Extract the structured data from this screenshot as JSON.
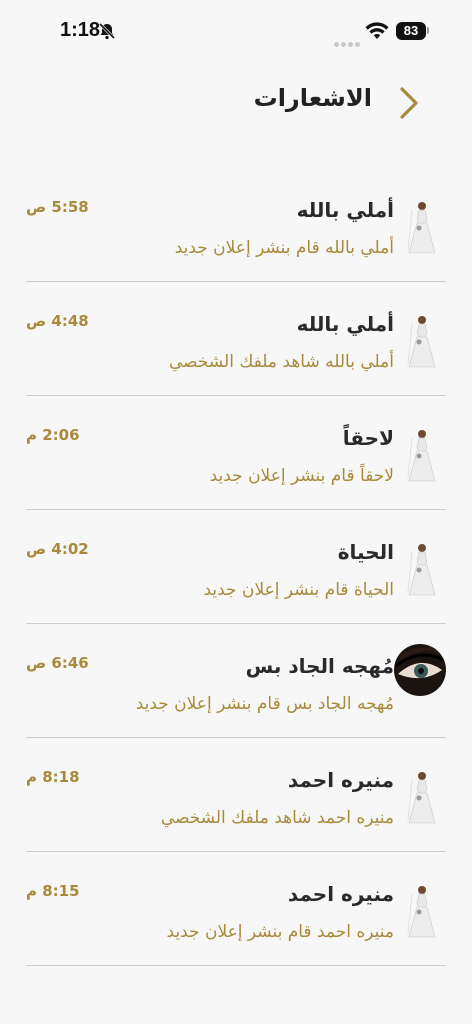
{
  "status": {
    "time": "1:18",
    "battery": "83"
  },
  "header": {
    "title": "الاشعارات"
  },
  "notifications": [
    {
      "name": "أملي بالله",
      "message": "أملي بالله قام بنشر إعلان جديد",
      "time": "5:58 ص",
      "avatar": "bride-icon"
    },
    {
      "name": "أملي بالله",
      "message": "أملي بالله شاهد ملفك الشخصي",
      "time": "4:48 ص",
      "avatar": "bride-icon"
    },
    {
      "name": "لاحقاً",
      "message": "لاحقاً قام بنشر إعلان جديد",
      "time": "2:06 م",
      "avatar": "bride-icon"
    },
    {
      "name": "الحياة",
      "message": "الحياة  قام بنشر إعلان جديد",
      "time": "4:02 ص",
      "avatar": "bride-icon"
    },
    {
      "name": "مُهجه الجاد بس",
      "message": "مُهجه الجاد بس قام بنشر إعلان جديد",
      "time": "6:46 ص",
      "avatar": "eye-photo"
    },
    {
      "name": "منيره  احمد",
      "message": "منيره  احمد شاهد ملفك الشخصي",
      "time": "8:18 م",
      "avatar": "bride-icon"
    },
    {
      "name": "منيره  احمد",
      "message": "منيره  احمد قام بنشر إعلان جديد",
      "time": "8:15 م",
      "avatar": "bride-icon"
    }
  ]
}
